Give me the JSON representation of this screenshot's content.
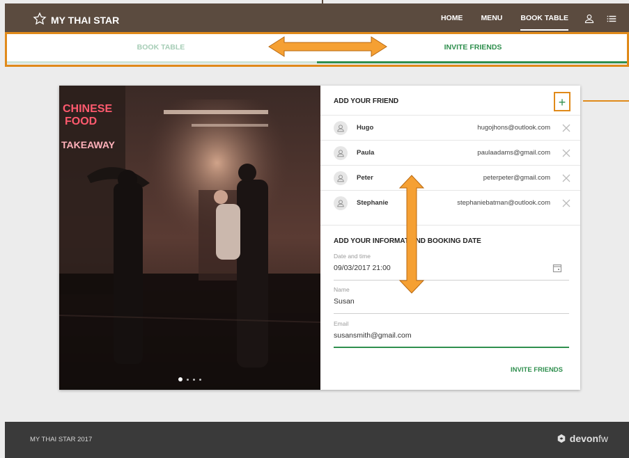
{
  "header": {
    "brand": "MY THAI STAR",
    "nav": [
      {
        "label": "HOME"
      },
      {
        "label": "MENU"
      },
      {
        "label": "BOOK TABLE"
      }
    ]
  },
  "tabs": {
    "book_table": "BOOK TABLE",
    "invite_friends": "INVITE FRIENDS"
  },
  "carousel": {
    "pages": 4,
    "active": 1
  },
  "friends": {
    "title": "ADD YOUR FRIEND",
    "add_label": "+",
    "list": [
      {
        "name": "Hugo",
        "email": "hugojhons@outlook.com"
      },
      {
        "name": "Paula",
        "email": "paulaadams@gmail.com"
      },
      {
        "name": "Peter",
        "email": "peterpeter@gmail.com"
      },
      {
        "name": "Stephanie",
        "email": "stephaniebatman@outlook.com"
      }
    ]
  },
  "info": {
    "title": "ADD YOUR INFORMAT  AND BOOKING DATE",
    "date_label": "Date and time",
    "date_value": "09/03/2017  21:00",
    "name_label": "Name",
    "name_value": "Susan",
    "email_label": "Email",
    "email_value": "susansmith@gmail.com",
    "submit": "INVITE FRIENDS"
  },
  "footer": {
    "copyright": "MY THAI STAR 2017",
    "logo_bold": "devon",
    "logo_light": "fw"
  },
  "colors": {
    "header_bg": "#5b4b3f",
    "accent_green": "#2f8f4e",
    "annotation_orange": "#e08a1a",
    "footer_bg": "#3a3a3a"
  }
}
